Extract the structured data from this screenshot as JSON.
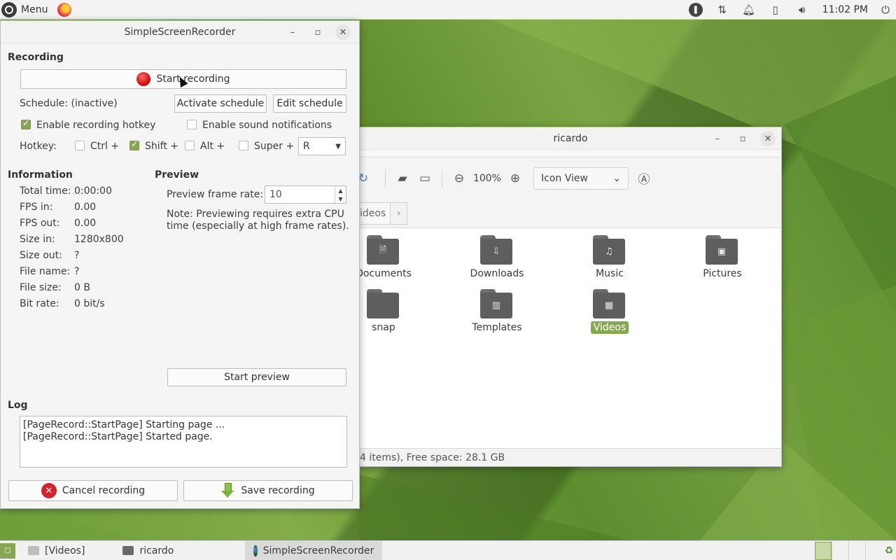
{
  "top_panel": {
    "menu_label": "Menu",
    "clock": "11:02 PM",
    "tray_icons": [
      "simplescreenrecorder-icon",
      "network-icon",
      "notification-bell-icon",
      "battery-icon",
      "volume-icon",
      "power-icon"
    ]
  },
  "ssr": {
    "title": "SimpleScreenRecorder",
    "recording": {
      "heading": "Recording",
      "start_button": "Start recording",
      "schedule_label": "Schedule: (inactive)",
      "activate_schedule": "Activate schedule",
      "edit_schedule": "Edit schedule",
      "enable_hotkey": "Enable recording hotkey",
      "enable_hotkey_checked": true,
      "enable_sound": "Enable sound notifications",
      "enable_sound_checked": false,
      "hotkey_label": "Hotkey:",
      "ctrl": "Ctrl +",
      "ctrl_checked": false,
      "shift": "Shift +",
      "shift_checked": true,
      "alt": "Alt +",
      "alt_checked": false,
      "super": "Super +",
      "super_checked": false,
      "key": "R"
    },
    "information": {
      "heading": "Information",
      "rows": [
        {
          "label": "Total time:",
          "value": "0:00:00"
        },
        {
          "label": "FPS in:",
          "value": "0.00"
        },
        {
          "label": "FPS out:",
          "value": "0.00"
        },
        {
          "label": "Size in:",
          "value": "1280x800"
        },
        {
          "label": "Size out:",
          "value": "?"
        },
        {
          "label": "File name:",
          "value": "?"
        },
        {
          "label": "File size:",
          "value": "0 B"
        },
        {
          "label": "Bit rate:",
          "value": "0 bit/s"
        }
      ]
    },
    "preview": {
      "heading": "Preview",
      "frame_rate_label": "Preview frame rate:",
      "frame_rate_value": "10",
      "note_line1": "Note: Previewing requires extra CPU",
      "note_line2": "time (especially at high frame rates).",
      "start_preview": "Start preview"
    },
    "log": {
      "heading": "Log",
      "lines": [
        "[PageRecord::StartPage] Starting page ...",
        "[PageRecord::StartPage] Started page."
      ]
    },
    "cancel_recording": "Cancel recording",
    "save_recording": "Save recording"
  },
  "files": {
    "title": "ricardo",
    "zoom": "100%",
    "view_mode": "Icon View",
    "crumb_partial": "ideos",
    "status": "4 items), Free space: 28.1 GB",
    "items": [
      {
        "label": "Documents",
        "glyph": "document-icon",
        "glyph_char": "🗎",
        "selected": false
      },
      {
        "label": "Downloads",
        "glyph": "download-icon",
        "glyph_char": "⇩",
        "selected": false
      },
      {
        "label": "Music",
        "glyph": "music-note-icon",
        "glyph_char": "♫",
        "selected": false
      },
      {
        "label": "Pictures",
        "glyph": "image-icon",
        "glyph_char": "▣",
        "selected": false
      },
      {
        "label": "snap",
        "glyph": "",
        "glyph_char": "",
        "selected": false
      },
      {
        "label": "Templates",
        "glyph": "template-icon",
        "glyph_char": "▥",
        "selected": false
      },
      {
        "label": "Videos",
        "glyph": "film-icon",
        "glyph_char": "▦",
        "selected": true
      }
    ]
  },
  "taskbar": {
    "tasks": [
      {
        "label": "[Videos]",
        "active": false
      },
      {
        "label": "ricardo",
        "active": false
      },
      {
        "label": "SimpleScreenRecorder",
        "active": true
      }
    ]
  },
  "colors": {
    "accent": "#87a752",
    "record_red": "#d10f0f",
    "folder_gray": "#5e5e5e"
  }
}
